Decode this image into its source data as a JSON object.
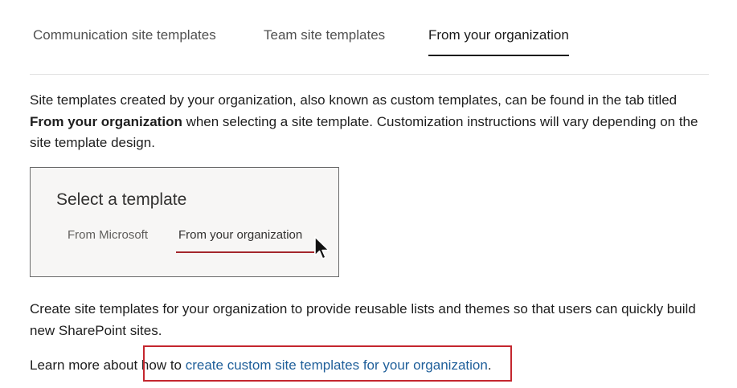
{
  "tabs": [
    {
      "label": "Communication site templates",
      "active": false
    },
    {
      "label": "Team site templates",
      "active": false
    },
    {
      "label": "From your organization",
      "active": true
    }
  ],
  "intro": {
    "text_before": "Site templates created by your organization, also known as custom templates, can be found in the tab titled ",
    "bold": "From your organization",
    "text_after": " when selecting a site template. Customization instructions will vary depending on the site template design."
  },
  "figure": {
    "title": "Select a template",
    "tab_microsoft": "From Microsoft",
    "tab_organization": "From your organization",
    "cursor_icon": "pointer-cursor-icon",
    "underline_color": "#a4262c"
  },
  "body_text": "Create site templates for your organization to provide reusable lists and themes so that users can quickly build new SharePoint sites.",
  "learn_more": {
    "prefix": "Learn more about ",
    "plain": "how to ",
    "link_text": "create custom site templates for your organization",
    "suffix": "."
  },
  "colors": {
    "link": "#1f5f9a",
    "highlight_border": "#c4262e"
  }
}
